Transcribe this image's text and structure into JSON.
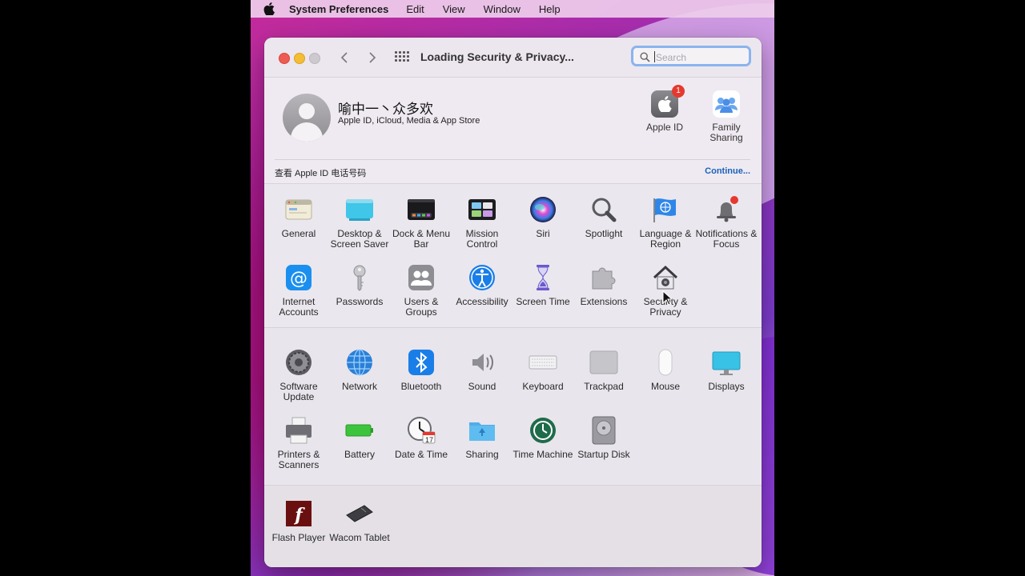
{
  "menubar": {
    "app": "System Preferences",
    "items": [
      "Edit",
      "View",
      "Window",
      "Help"
    ]
  },
  "window": {
    "title": "Loading Security & Privacy...",
    "search": {
      "placeholder": "Search",
      "value": ""
    }
  },
  "account": {
    "name": "喻中一丶众多欢",
    "subtitle": "Apple ID, iCloud, Media & App Store",
    "apple_id": {
      "label": "Apple ID",
      "badge": "1"
    },
    "family_sharing": {
      "label": "Family Sharing"
    },
    "notice": "查看 Apple ID 电话号码",
    "continue_label": "Continue..."
  },
  "sections": [
    {
      "items": [
        {
          "label": "General",
          "icon": "general-icon"
        },
        {
          "label": "Desktop & Screen Saver",
          "icon": "desktop-icon"
        },
        {
          "label": "Dock & Menu Bar",
          "icon": "dock-icon"
        },
        {
          "label": "Mission Control",
          "icon": "mission-control-icon"
        },
        {
          "label": "Siri",
          "icon": "siri-icon"
        },
        {
          "label": "Spotlight",
          "icon": "spotlight-icon"
        },
        {
          "label": "Language & Region",
          "icon": "language-icon"
        },
        {
          "label": "Notifications & Focus",
          "icon": "notifications-icon"
        },
        {
          "label": "Internet Accounts",
          "icon": "internet-accounts-icon"
        },
        {
          "label": "Passwords",
          "icon": "key-icon"
        },
        {
          "label": "Users & Groups",
          "icon": "users-icon"
        },
        {
          "label": "Accessibility",
          "icon": "accessibility-icon"
        },
        {
          "label": "Screen Time",
          "icon": "hourglass-icon"
        },
        {
          "label": "Extensions",
          "icon": "puzzle-icon"
        },
        {
          "label": "Security & Privacy",
          "icon": "security-house-icon"
        }
      ]
    },
    {
      "items": [
        {
          "label": "Software Update",
          "icon": "gear-icon"
        },
        {
          "label": "Network",
          "icon": "globe-icon"
        },
        {
          "label": "Bluetooth",
          "icon": "bluetooth-icon"
        },
        {
          "label": "Sound",
          "icon": "speaker-icon"
        },
        {
          "label": "Keyboard",
          "icon": "keyboard-icon"
        },
        {
          "label": "Trackpad",
          "icon": "trackpad-icon"
        },
        {
          "label": "Mouse",
          "icon": "mouse-icon"
        },
        {
          "label": "Displays",
          "icon": "display-icon"
        },
        {
          "label": "Printers & Scanners",
          "icon": "printer-icon"
        },
        {
          "label": "Battery",
          "icon": "battery-icon"
        },
        {
          "label": "Date & Time",
          "icon": "clock-icon",
          "calendar_day": "17"
        },
        {
          "label": "Sharing",
          "icon": "sharing-folder-icon"
        },
        {
          "label": "Time Machine",
          "icon": "time-machine-icon"
        },
        {
          "label": "Startup Disk",
          "icon": "disk-icon"
        }
      ]
    },
    {
      "items": [
        {
          "label": "Flash Player",
          "icon": "flash-icon"
        },
        {
          "label": "Wacom Tablet",
          "icon": "tablet-icon"
        }
      ]
    }
  ]
}
